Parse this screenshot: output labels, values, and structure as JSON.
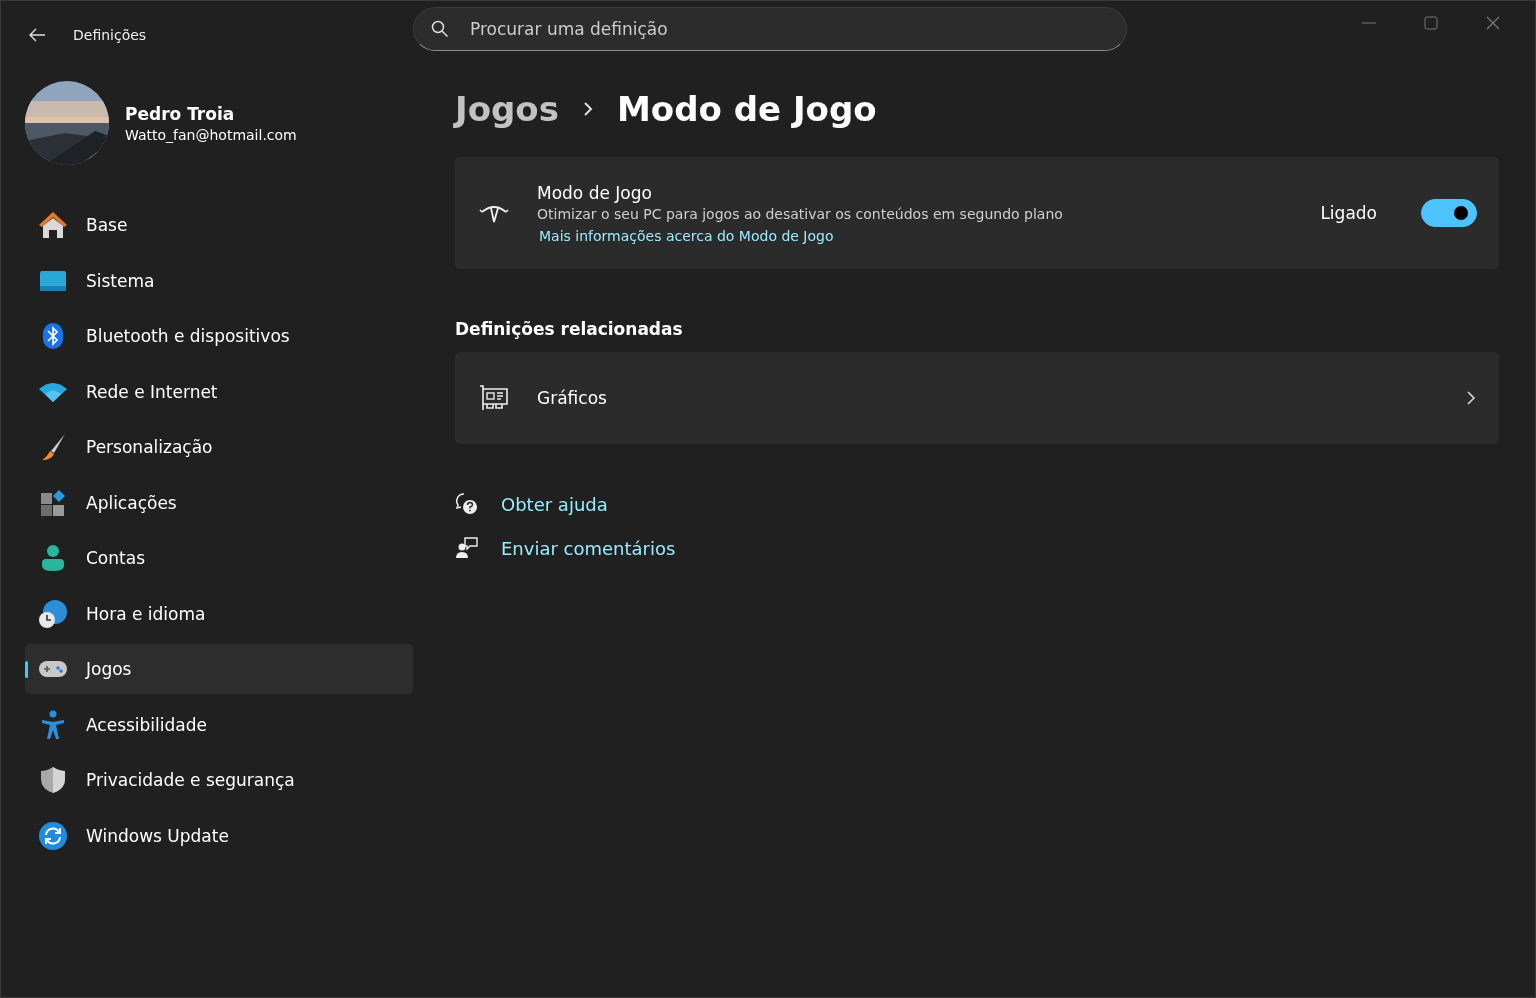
{
  "window": {
    "title": "Definições"
  },
  "search": {
    "placeholder": "Procurar uma definição"
  },
  "profile": {
    "name": "Pedro Troia",
    "email": "Watto_fan@hotmail.com"
  },
  "nav": [
    {
      "label": "Base",
      "selected": false
    },
    {
      "label": "Sistema",
      "selected": false
    },
    {
      "label": "Bluetooth e dispositivos",
      "selected": false
    },
    {
      "label": "Rede e Internet",
      "selected": false
    },
    {
      "label": "Personalização",
      "selected": false
    },
    {
      "label": "Aplicações",
      "selected": false
    },
    {
      "label": "Contas",
      "selected": false
    },
    {
      "label": "Hora e idioma",
      "selected": false
    },
    {
      "label": "Jogos",
      "selected": true
    },
    {
      "label": "Acessibilidade",
      "selected": false
    },
    {
      "label": "Privacidade e segurança",
      "selected": false
    },
    {
      "label": "Windows Update",
      "selected": false
    }
  ],
  "breadcrumb": [
    "Jogos",
    "Modo de Jogo"
  ],
  "game_mode": {
    "title": "Modo de Jogo",
    "description": "Otimizar o seu PC para jogos ao desativar os conteúdos em segundo plano",
    "link": "Mais informações acerca do Modo de Jogo",
    "state_label": "Ligado",
    "on": true
  },
  "related": {
    "heading": "Definições relacionadas",
    "items": [
      {
        "label": "Gráficos"
      }
    ]
  },
  "help_links": [
    "Obter ajuda",
    "Enviar comentários"
  ]
}
